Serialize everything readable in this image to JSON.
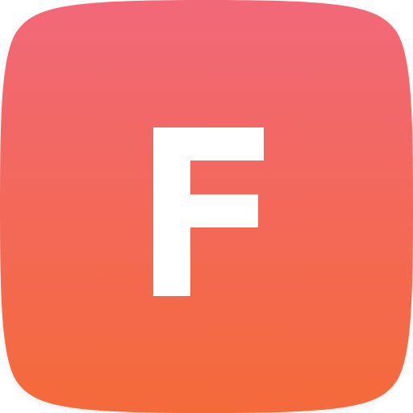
{
  "app_icon": {
    "letter": "F",
    "icon_name": "app-icon-letter-f",
    "colors": {
      "gradient_top": "#F26779",
      "gradient_bottom": "#F46A3A",
      "letter": "#FFFFFF"
    }
  }
}
